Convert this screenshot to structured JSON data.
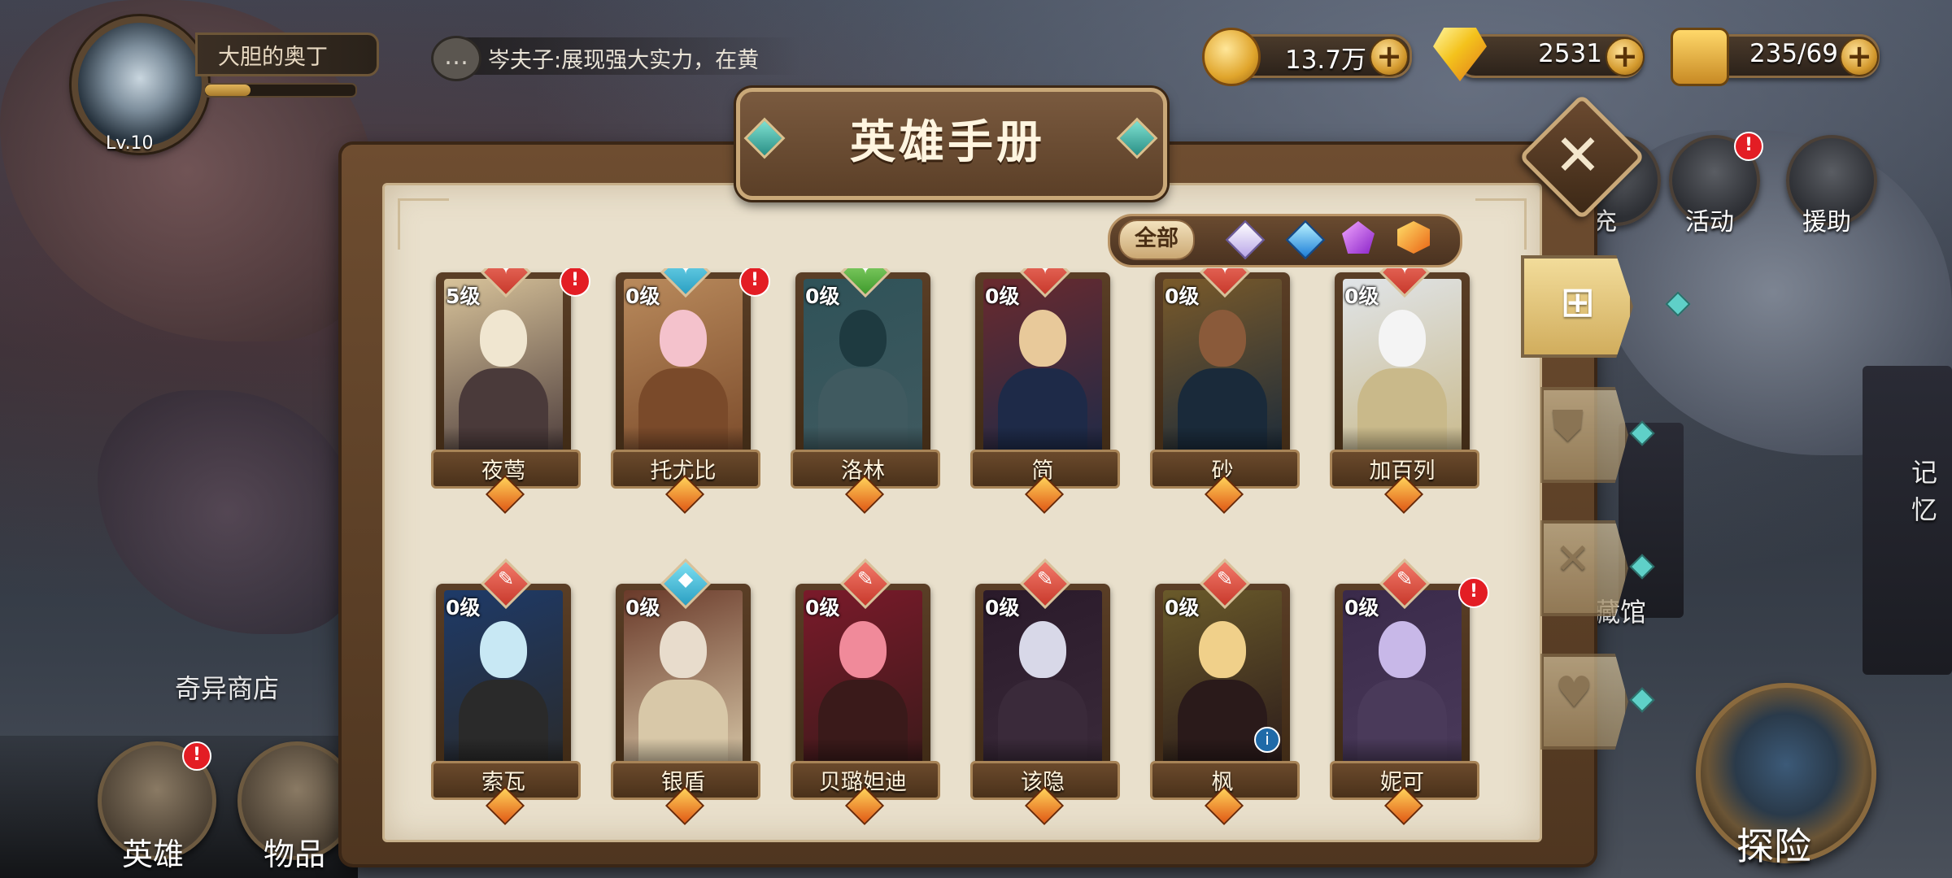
{
  "player": {
    "name": "大胆的奥丁",
    "level": "Lv.10",
    "xp_fraction": 0.3
  },
  "chat": {
    "message": "岑夫子:展现强大实力，在黄"
  },
  "currencies": {
    "gold": "13.7万",
    "gems": "2531",
    "stamina": "235/69"
  },
  "side_menu": {
    "recharge_partial": "充",
    "activity": "活动",
    "support": "援助",
    "memory_partial": "记忆",
    "collection_partial": "藏馆"
  },
  "bottom_menu": {
    "heroes": "英雄",
    "items": "物品",
    "shop": "奇异商店"
  },
  "explore": "探险",
  "panel": {
    "title": "英雄手册",
    "close": "✕",
    "filter_all": "全部",
    "filter_gems": [
      "white-diamond-icon",
      "blue-diamond-icon",
      "purple-pentagon-icon",
      "orange-hexagon-icon"
    ],
    "tabs": [
      {
        "icon": "grid-icon",
        "active": true
      },
      {
        "icon": "shield-icon",
        "active": false
      },
      {
        "icon": "sword-icon",
        "active": false
      },
      {
        "icon": "heart-icon",
        "active": false
      }
    ]
  },
  "heroes_row1": [
    {
      "level": "5级",
      "name": "夜莺"
    },
    {
      "level": "0级",
      "name": "托尤比"
    },
    {
      "level": "0级",
      "name": "洛林"
    },
    {
      "level": "0级",
      "name": "简"
    },
    {
      "level": "0级",
      "name": "砂"
    },
    {
      "level": "0级",
      "name": "加百列"
    }
  ],
  "heroes_row2": [
    {
      "level": "0级",
      "name": "索瓦"
    },
    {
      "level": "0级",
      "name": "银盾"
    },
    {
      "level": "0级",
      "name": "贝璐妲迪"
    },
    {
      "level": "0级",
      "name": "该隐"
    },
    {
      "level": "0级",
      "name": "枫"
    },
    {
      "level": "0级",
      "name": "妮可"
    }
  ],
  "badge_mark": "!",
  "info_mark": "i",
  "colors": {
    "panel_bg": "#e9e0cc",
    "frame_brown": "#5a3e26",
    "badge_red": "#e31d24",
    "accent_teal": "#5fd0c8"
  }
}
